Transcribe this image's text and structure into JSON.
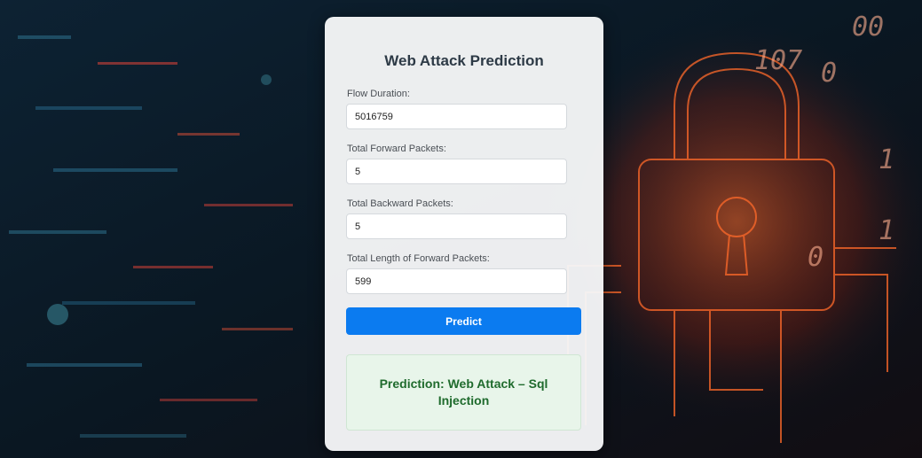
{
  "form": {
    "title": "Web Attack Prediction",
    "fields": [
      {
        "label": "Flow Duration:",
        "value": "5016759"
      },
      {
        "label": "Total Forward Packets:",
        "value": "5"
      },
      {
        "label": "Total Backward Packets:",
        "value": "5"
      },
      {
        "label": "Total Length of Forward Packets:",
        "value": "599"
      }
    ],
    "predict_label": "Predict"
  },
  "result": {
    "text": "Prediction: Web Attack – Sql Injection"
  },
  "colors": {
    "button": "#0b7bf0",
    "result_bg": "#e8f5ea",
    "result_text": "#1f6b2d",
    "lock_glow": "#ff5a1f"
  },
  "background": {
    "numbers": [
      "107",
      "0",
      "00",
      "1",
      "0",
      "1"
    ]
  }
}
